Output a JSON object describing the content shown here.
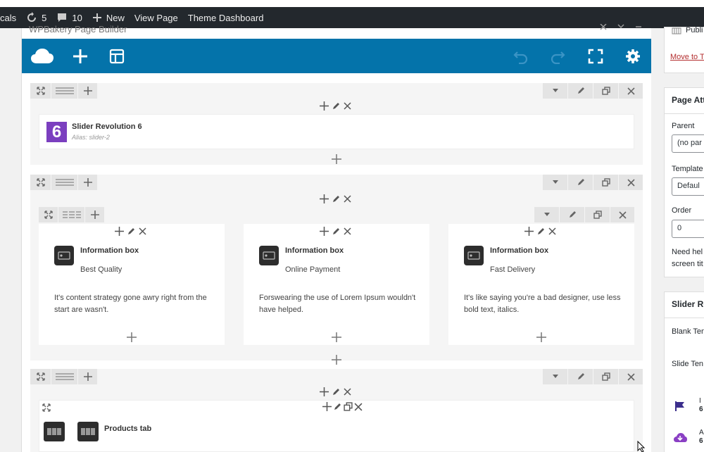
{
  "adminbar": {
    "site_label": "cals",
    "updates_count": "5",
    "comments_count": "10",
    "new_label": "New",
    "view_page_label": "View Page",
    "theme_dashboard_label": "Theme Dashboard"
  },
  "builder": {
    "title": "WPBakery Page Builder"
  },
  "rows": {
    "slider": {
      "title": "Slider Revolution 6",
      "alias": "Alias: slider-2",
      "badge": "6"
    },
    "info": {
      "boxes": [
        {
          "title": "Information box",
          "subtitle": "Best Quality",
          "text": "It's content strategy gone awry right from the start are wasn't."
        },
        {
          "title": "Information box",
          "subtitle": "Online Payment",
          "text": "Forswearing the use of Lorem Ipsum wouldn't have helped."
        },
        {
          "title": "Information box",
          "subtitle": "Fast Delivery",
          "text": "It's like saying you're a bad designer, use less bold text, italics."
        }
      ]
    },
    "products": {
      "title": "Products tab"
    }
  },
  "sidebar": {
    "publish_label": "Publi",
    "trash_label": "Move to T",
    "page_attributes_title": "Page Att",
    "parent_label": "Parent",
    "parent_value": "(no par",
    "template_label": "Template",
    "template_value": "Defaul",
    "order_label": "Order",
    "order_value": "0",
    "help_line1": "Need hel",
    "help_line2": "screen tit",
    "slider_box_title": "Slider Re",
    "blank_template": "Blank Ten",
    "slide_template": "Slide Ten",
    "item1_a": "I",
    "item1_b": "6",
    "item2_a": "A",
    "item2_b": "6"
  },
  "colors": {
    "toolbar": "#0473aa",
    "adminbar": "#23282d",
    "slider_badge": "#7b3fbf",
    "sidebar_flag": "#3b2e8c"
  }
}
